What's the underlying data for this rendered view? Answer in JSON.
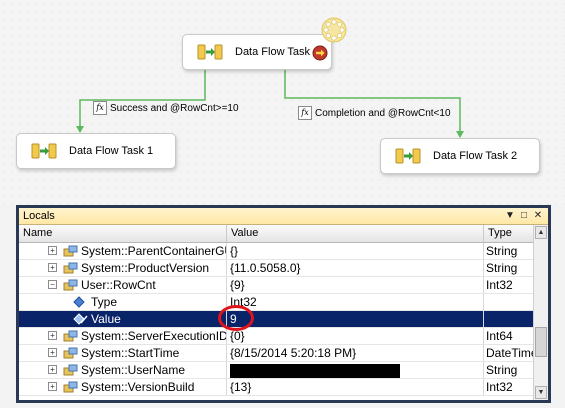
{
  "designer": {
    "task_main": "Data Flow Task",
    "task_1": "Data Flow Task 1",
    "task_2": "Data Flow Task 2",
    "precedence_1": "Success and @RowCnt>=10",
    "precedence_2": "Completion and @RowCnt<10",
    "fx_symbol": "fx"
  },
  "locals": {
    "title": "Locals",
    "columns": {
      "name": "Name",
      "value": "Value",
      "type": "Type"
    },
    "rows": [
      {
        "name": "System::ParentContainerGUID",
        "value": "{}",
        "type": "String"
      },
      {
        "name": "System::ProductVersion",
        "value": "{11.0.5058.0}",
        "type": "String"
      },
      {
        "name": "User::RowCnt",
        "value": "{9}",
        "type": "Int32"
      },
      {
        "name": "Type",
        "value": "Int32",
        "type": ""
      },
      {
        "name": "Value",
        "value": "9",
        "type": ""
      },
      {
        "name": "System::ServerExecutionID",
        "value": "{0}",
        "type": "Int64"
      },
      {
        "name": "System::StartTime",
        "value": "{8/15/2014 5:20:18 PM}",
        "type": "DateTime"
      },
      {
        "name": "System::UserName",
        "value": "",
        "type": "String"
      },
      {
        "name": "System::VersionBuild",
        "value": "{13}",
        "type": "Int32"
      }
    ]
  },
  "colors": {
    "selection": "#0a246a",
    "highlight_circle": "#e0121a",
    "connector": "#5cb85c"
  }
}
